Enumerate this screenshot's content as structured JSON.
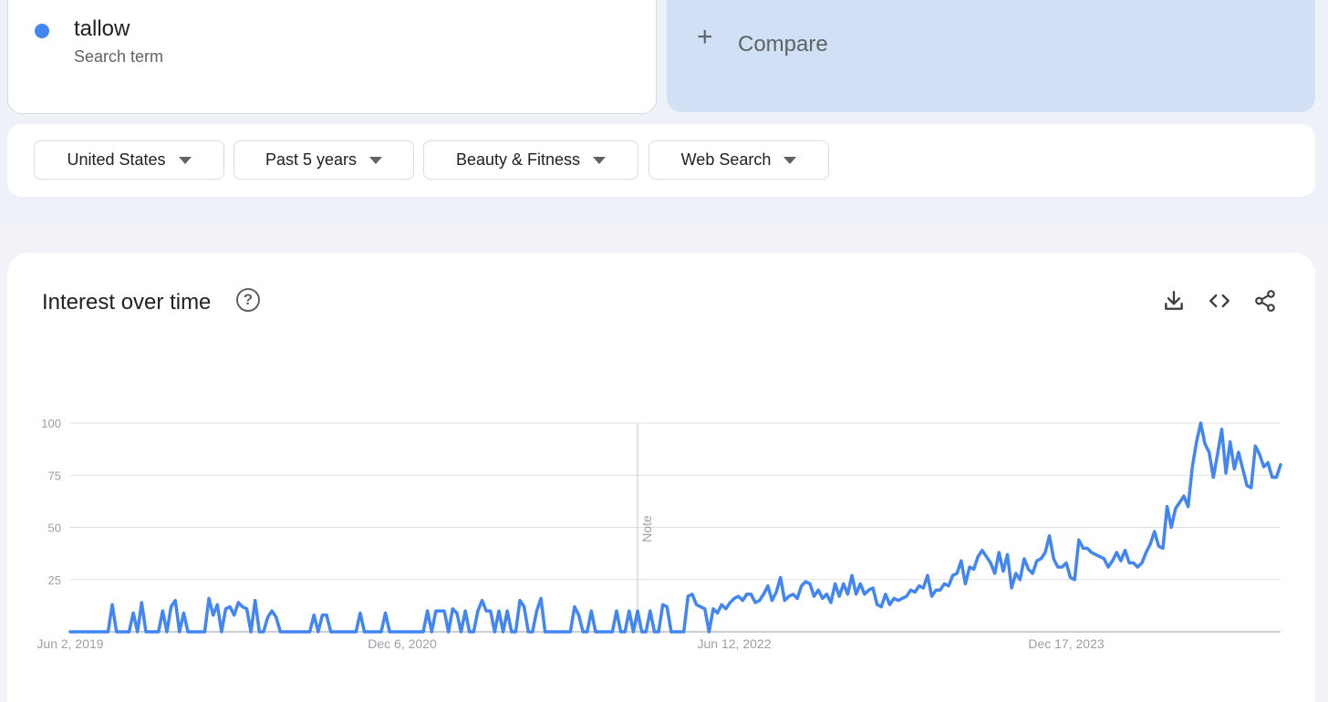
{
  "search_term": {
    "name": "tallow",
    "type": "Search term",
    "color": "#4285f4"
  },
  "compare": {
    "label": "Compare",
    "icon": "plus-icon"
  },
  "filters": [
    {
      "label": "United States",
      "icon": "caret-down-icon"
    },
    {
      "label": "Past 5 years",
      "icon": "caret-down-icon"
    },
    {
      "label": "Beauty & Fitness",
      "icon": "caret-down-icon"
    },
    {
      "label": "Web Search",
      "icon": "caret-down-icon"
    }
  ],
  "chart_panel": {
    "title": "Interest over time",
    "icons": [
      "help-icon",
      "download-icon",
      "embed-code-icon",
      "share-icon"
    ]
  },
  "chart_data": {
    "type": "line",
    "title": "Interest over time",
    "xlabel": "",
    "ylabel": "",
    "ylim": [
      0,
      100
    ],
    "yticks": [
      100,
      75,
      50,
      25
    ],
    "xtick_labels": [
      "Jun 2, 2019",
      "Dec 6, 2020",
      "Jun 12, 2022",
      "Dec 17, 2023"
    ],
    "xtick_weeks": [
      0,
      79,
      158,
      237
    ],
    "annotation": {
      "label": "Note",
      "week": 135
    },
    "grid": true,
    "series": [
      {
        "color": "#4285f4",
        "values": [
          0,
          0,
          0,
          0,
          0,
          0,
          0,
          0,
          0,
          0,
          13,
          0,
          0,
          0,
          0,
          9,
          0,
          14,
          0,
          0,
          0,
          0,
          10,
          0,
          12,
          15,
          0,
          9,
          0,
          0,
          0,
          0,
          0,
          16,
          8,
          13,
          0,
          11,
          12,
          8,
          14,
          12,
          11,
          0,
          15,
          0,
          0,
          7,
          10,
          7,
          0,
          0,
          0,
          0,
          0,
          0,
          0,
          0,
          8,
          0,
          8,
          8,
          0,
          0,
          0,
          0,
          0,
          0,
          0,
          9,
          0,
          0,
          0,
          0,
          0,
          9,
          0,
          0,
          0,
          0,
          0,
          0,
          0,
          0,
          0,
          10,
          0,
          10,
          10,
          10,
          0,
          11,
          9,
          0,
          10,
          0,
          0,
          10,
          15,
          10,
          10,
          0,
          10,
          0,
          10,
          0,
          0,
          15,
          12,
          0,
          0,
          10,
          16,
          0,
          0,
          0,
          0,
          0,
          0,
          0,
          12,
          8,
          0,
          0,
          10,
          0,
          0,
          0,
          0,
          0,
          10,
          0,
          0,
          10,
          0,
          10,
          0,
          0,
          10,
          0,
          0,
          13,
          12,
          0,
          0,
          0,
          0,
          17,
          18,
          13,
          12,
          11,
          0,
          11,
          9,
          13,
          11,
          14,
          16,
          17,
          15,
          18,
          18,
          14,
          15,
          18,
          22,
          15,
          19,
          26,
          15,
          17,
          18,
          16,
          22,
          24,
          23,
          17,
          20,
          16,
          18,
          14,
          23,
          17,
          23,
          18,
          27,
          18,
          23,
          18,
          20,
          21,
          13,
          12,
          18,
          13,
          16,
          15,
          16,
          17,
          20,
          19,
          22,
          21,
          27,
          17,
          20,
          20,
          23,
          22,
          27,
          28,
          34,
          23,
          31,
          30,
          36,
          39,
          36,
          33,
          28,
          38,
          29,
          37,
          21,
          28,
          25,
          35,
          30,
          28,
          34,
          35,
          38,
          46,
          35,
          31,
          31,
          33,
          26,
          25,
          44,
          40,
          40,
          38,
          37,
          36,
          35,
          31,
          34,
          38,
          34,
          39,
          33,
          33,
          31,
          33,
          38,
          42,
          48,
          41,
          40,
          60,
          50,
          59,
          62,
          65,
          60,
          79,
          91,
          100,
          90,
          86,
          74,
          85,
          97,
          76,
          91,
          78,
          86,
          78,
          70,
          69,
          89,
          85,
          79,
          81,
          74,
          74,
          80
        ]
      }
    ]
  }
}
